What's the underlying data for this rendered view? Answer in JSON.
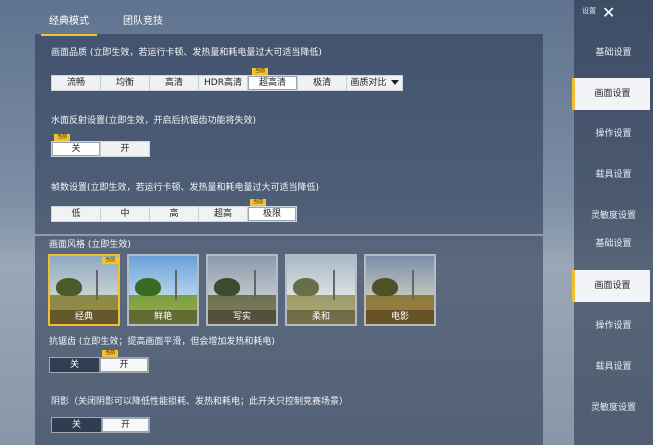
{
  "tabs": [
    {
      "label": "经典模式",
      "active": true
    },
    {
      "label": "团队竞技",
      "active": false
    }
  ],
  "header": {
    "settings_label": "设置",
    "close_icon": "close-icon"
  },
  "right_menu_top": [
    {
      "label": "基础设置",
      "active": false
    },
    {
      "label": "画面设置",
      "active": true
    },
    {
      "label": "操作设置",
      "active": false
    },
    {
      "label": "载具设置",
      "active": false
    },
    {
      "label": "灵敏度设置",
      "active": false
    }
  ],
  "right_menu_bottom": [
    {
      "label": "基础设置",
      "active": false
    },
    {
      "label": "画面设置",
      "active": true
    },
    {
      "label": "操作设置",
      "active": false
    },
    {
      "label": "载具设置",
      "active": false
    },
    {
      "label": "灵敏度设置",
      "active": false
    }
  ],
  "current_badge": "当前",
  "quality": {
    "title": "画面品质 (立即生效，若运行卡顿、发热量和耗电量过大可适当降低)",
    "options": [
      "流畅",
      "均衡",
      "高清",
      "HDR高清",
      "超高清",
      "极清",
      "画质对比"
    ],
    "selected": 4
  },
  "water": {
    "title": "水面反射设置(立即生效，开启后抗锯齿功能将失效)",
    "options": [
      "关",
      "开"
    ],
    "selected": 0
  },
  "fps": {
    "title": "帧数设置(立即生效，若运行卡顿、发热量和耗电量过大可适当降低)",
    "options": [
      "低",
      "中",
      "高",
      "超高",
      "极限"
    ],
    "selected": 4
  },
  "style": {
    "title": "画面风格 (立即生效)",
    "options": [
      "经典",
      "鲜艳",
      "写实",
      "柔和",
      "电影"
    ],
    "selected": 0
  },
  "antialias": {
    "title": "抗锯齿 (立即生效；提高画面平滑，但会增加发热和耗电)",
    "options": [
      "关",
      "开"
    ],
    "selected": 1
  },
  "shadow": {
    "title": "阴影（关闭阴影可以降低性能损耗、发热和耗电；此开关只控制竞赛场景）",
    "options": [
      "关",
      "开"
    ],
    "selected": 1
  },
  "colors": {
    "accent": "#f0c030",
    "badge": "#f2c233"
  }
}
